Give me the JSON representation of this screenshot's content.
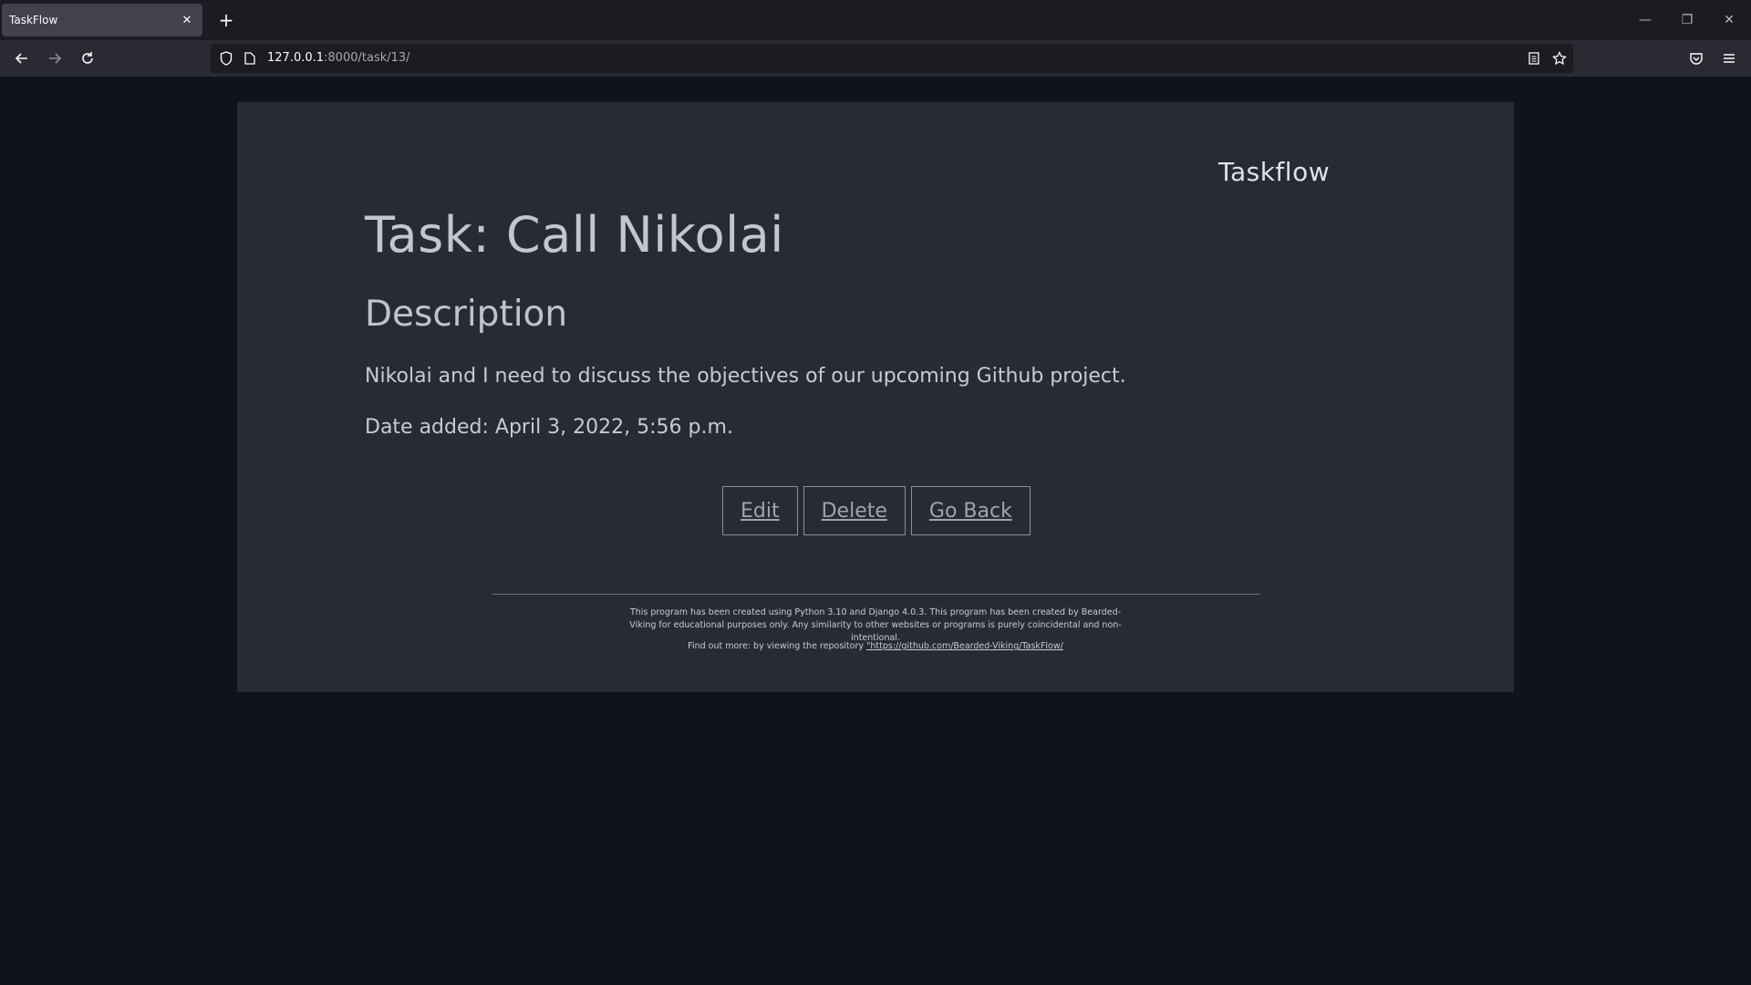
{
  "browser": {
    "tab_title": "TaskFlow",
    "tab_close": "✕",
    "new_tab": "+",
    "url_host": "127.0.0.1",
    "url_path": ":8000/task/13/",
    "window_controls": {
      "minimize": "—",
      "restore": "❐",
      "close": "✕"
    }
  },
  "page": {
    "brand": "Taskflow",
    "title": "Task: Call Nikolai",
    "description_heading": "Description",
    "description": "Nikolai and I need to discuss the objectives of our upcoming Github project.",
    "date_label": "Date added:",
    "date_value": "April 3, 2022, 5:56 p.m.",
    "buttons": {
      "edit": "Edit",
      "delete": "Delete",
      "back": "Go Back"
    }
  },
  "footer": {
    "text": "This program has been created using Python 3.10 and Django 4.0.3. This program has been created by Bearded-Viking for educational purposes only. Any similarity to other websites or programs is purely coincidental and non-intentional.",
    "repo_prefix": "Find out more: by viewing the repository",
    "repo_link": "\"https://github.com/Bearded-Viking/TaskFlow/"
  },
  "colors": {
    "background": "#0f131b",
    "card": "#272b35",
    "text": "#c7cbd2"
  }
}
